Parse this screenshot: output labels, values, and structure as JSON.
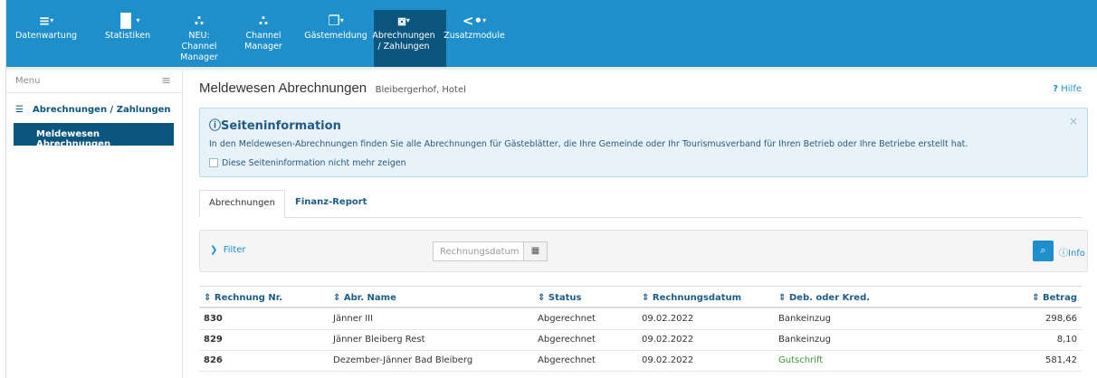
{
  "colors": {
    "accent": "#1e8fcb",
    "nav_active": "#0b567f",
    "info_bg": "#e7f2fb",
    "credit_green": "#3b9a36"
  },
  "nav": {
    "items": [
      {
        "label1": "Datenwartung",
        "label2": "",
        "icon": "bed-icon"
      },
      {
        "label1": "Statistiken",
        "label2": "",
        "icon": "bar-chart-icon"
      },
      {
        "label1": "NEU: Channel",
        "label2": "Manager",
        "icon": "sitemap-icon"
      },
      {
        "label1": "Channel",
        "label2": "Manager",
        "icon": "sitemap-icon"
      },
      {
        "label1": "Gästemeldung",
        "label2": "",
        "icon": "documents-icon"
      },
      {
        "label1": "Abrechnungen",
        "label2": "/ Zahlungen",
        "icon": "money-icon"
      },
      {
        "label1": "Zusatzmodule",
        "label2": "",
        "icon": "share-icon"
      }
    ]
  },
  "sidebar": {
    "menu_label": "Menu",
    "section": "Abrechnungen / Zahlungen",
    "active_item": "Meldewesen Abrechnungen"
  },
  "header": {
    "title": "Meldewesen Abrechnungen",
    "subtitle": "Bleibergerhof, Hotel",
    "help": "Hilfe"
  },
  "info": {
    "title": "Seiteninformation",
    "text": "In den Meldewesen-Abrechnungen finden Sie alle Abrechnungen für Gästeblätter, die Ihre Gemeinde oder Ihr Tourismusverband für Ihren Betrieb oder Ihre Betriebe erstellt hat.",
    "checkbox": "Diese Seiteninformation nicht mehr zeigen"
  },
  "tabs": {
    "active": "Abrechnungen",
    "other": "Finanz-Report"
  },
  "filter": {
    "toggle": "Filter",
    "date_placeholder": "Rechnungsdatum",
    "info": "Info"
  },
  "table": {
    "headers": [
      "Rechnung Nr.",
      "Abr. Name",
      "Status",
      "Rechnungsdatum",
      "Deb. oder Kred.",
      "Betrag"
    ],
    "rows": [
      {
        "nr": "830",
        "name": "Jänner III",
        "status": "Abgerechnet",
        "date": "09.02.2022",
        "type": "Bankeinzug",
        "amount": "298,66"
      },
      {
        "nr": "829",
        "name": "Jänner Bleiberg Rest",
        "status": "Abgerechnet",
        "date": "09.02.2022",
        "type": "Bankeinzug",
        "amount": "8,10"
      },
      {
        "nr": "826",
        "name": "Dezember-Jänner Bad Bleiberg",
        "status": "Abgerechnet",
        "date": "09.02.2022",
        "type": "Gutschrift",
        "amount": "581,42"
      }
    ]
  }
}
